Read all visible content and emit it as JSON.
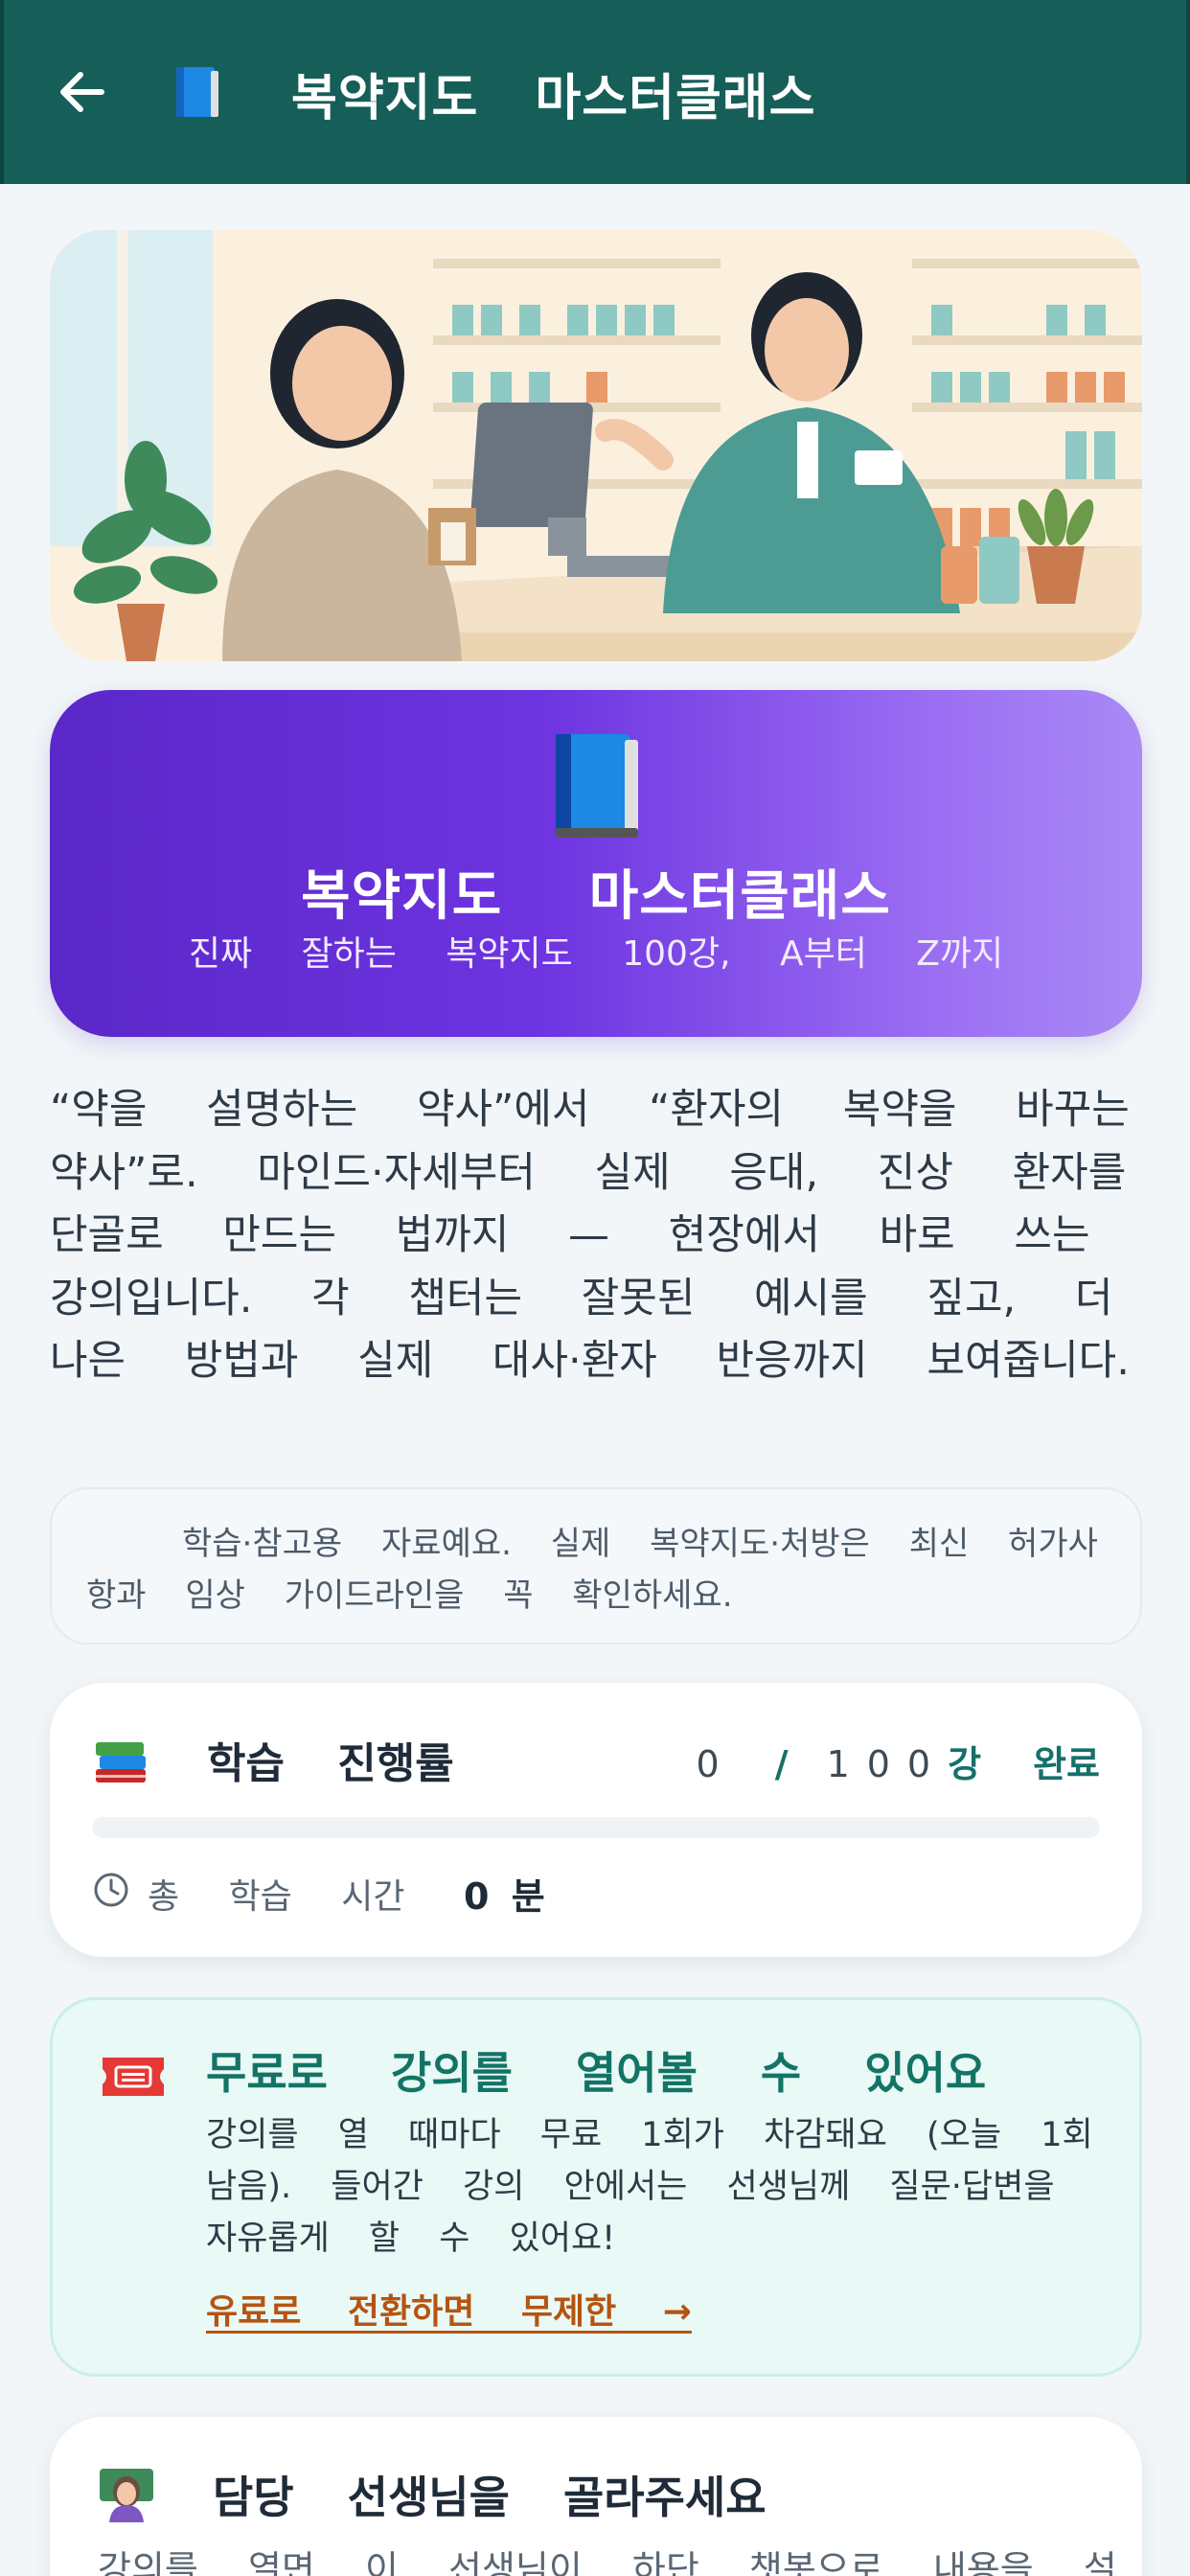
{
  "appbar": {
    "title": "복약지도 마스터클래스",
    "back_icon": "arrow-left-icon",
    "book_icon": "blue-book-icon"
  },
  "banner": {
    "icon": "blue-book-icon",
    "title": "복약지도 마스터클래스",
    "subtitle": "진짜 잘하는 복약지도 100강, A부터 Z까지"
  },
  "intro": {
    "text": "“약을 설명하는 약사”에서 “환자의 복약을 바꾸는 약사”로. 마인드·자세부터 실제 응대, 진상 환자를 단골로 만드는 법까지 — 현장에서 바로 쓰는 강의입니다. 각 챕터는 잘못된 예시를 짚고, 더 나은 방법과 실제 대사·환자 반응까지 보여줍니다."
  },
  "notice": {
    "text": "학습·참고용 자료예요. 실제 복약지도·처방은 최신 허가사항과 임상 가이드라인을 꼭 확인하세요."
  },
  "progress": {
    "icon": "books-icon",
    "title": "학습 진행률",
    "done_count": "0",
    "slash": "/",
    "total_count": "100",
    "unit": "강",
    "done_label": "완료",
    "fraction": 0,
    "clock_icon": "clock-icon",
    "time_label": "총 학습 시간",
    "time_value": "0",
    "time_unit": "분"
  },
  "free": {
    "icon": "ticket-icon",
    "title": "무료로 강의를 열어볼 수 있어요",
    "body": "강의를 열 때마다 무료 1회가 차감돼요 (오늘 1회 남음). 들어간 강의 안에서는 선생님께 질문·답변을 자유롭게 할 수 있어요!",
    "link": "유료로 전환하면 무제한 →"
  },
  "teacher": {
    "icon": "teacher-icon",
    "title": "담당 선생님을 골라주세요",
    "subtitle": "강의를 열면 이 선생님이 하단 챗봇으로 내용을 설"
  },
  "colors": {
    "appbar": "#165e58",
    "accent": "#16706a",
    "banner_start": "#5a27c8",
    "banner_end": "#a98af5",
    "free_bg": "#e9f9f5",
    "link": "#b55412"
  }
}
